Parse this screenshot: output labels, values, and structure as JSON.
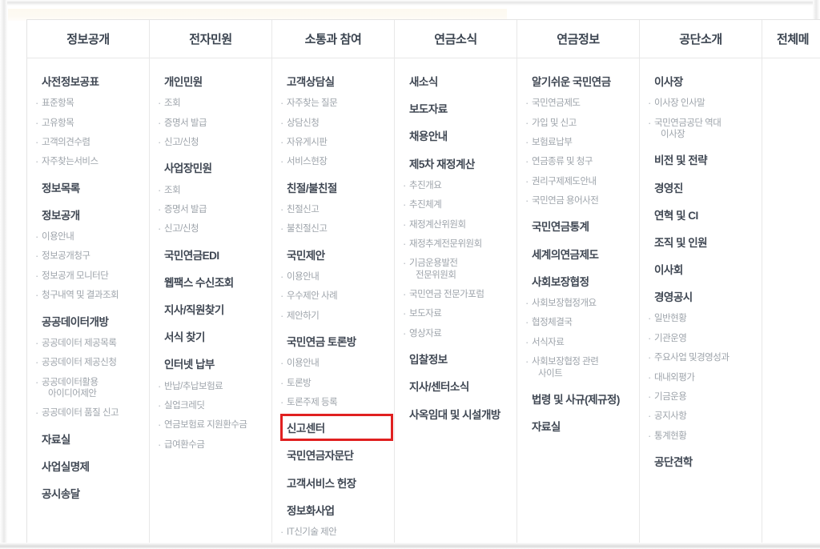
{
  "menu": {
    "columns": [
      {
        "id": "col-information-disclosure",
        "header": "정보공개",
        "groups": [
          {
            "title": "사전정보공표",
            "items": [
              "표준항목",
              "고유항목",
              "고객의견수렴",
              "자주찾는서비스"
            ]
          },
          {
            "title": "정보목록",
            "items": []
          },
          {
            "title": "정보공개",
            "items": [
              "이용안내",
              "정보공개청구",
              "정보공개 모니터단",
              "청구내역 및 결과조회"
            ]
          },
          {
            "title": "공공데이터개방",
            "items": [
              "공공데이터 제공목록",
              "공공데이터 제공신청",
              "공공데이터활용|아이디어제안",
              "공공데이터 품질 신고"
            ]
          },
          {
            "title": "자료실",
            "items": []
          },
          {
            "title": "사업실명제",
            "items": []
          },
          {
            "title": "공시송달",
            "items": []
          }
        ]
      },
      {
        "id": "col-electronic-civil-service",
        "header": "전자민원",
        "groups": [
          {
            "title": "개인민원",
            "items": [
              "조회",
              "증명서 발급",
              "신고/신청"
            ]
          },
          {
            "title": "사업장민원",
            "items": [
              "조회",
              "증명서 발급",
              "신고/신청"
            ]
          },
          {
            "title": "국민연금EDI",
            "items": []
          },
          {
            "title": "웹팩스 수신조회",
            "items": []
          },
          {
            "title": "지사/직원찾기",
            "items": []
          },
          {
            "title": "서식 찾기",
            "items": []
          },
          {
            "title": "인터넷 납부",
            "items": [
              "반납/추납보험료",
              "실업크레딧",
              "연금보험료 지원환수금",
              "급여환수금"
            ]
          }
        ]
      },
      {
        "id": "col-communication-participation",
        "header": "소통과 참여",
        "groups": [
          {
            "title": "고객상담실",
            "items": [
              "자주찾는 질문",
              "상담신청",
              "자유게시판",
              "서비스현장"
            ]
          },
          {
            "title": "친절/불친절",
            "items": [
              "친절신고",
              "불친절신고"
            ]
          },
          {
            "title": "국민제안",
            "items": [
              "이용안내",
              "우수제안 사례",
              "제안하기"
            ]
          },
          {
            "title": "국민연금 토론방",
            "items": [
              "이용안내",
              "토론방",
              "토론주제 등록"
            ]
          },
          {
            "title": "신고센터",
            "items": [],
            "highlighted": true
          },
          {
            "title": "국민연금자문단",
            "items": []
          },
          {
            "title": "고객서비스 헌장",
            "items": []
          },
          {
            "title": "정보화사업",
            "items": [
              "IT신기술 제안"
            ]
          }
        ]
      },
      {
        "id": "col-pension-news",
        "header": "연금소식",
        "groups": [
          {
            "title": "새소식",
            "items": []
          },
          {
            "title": "보도자료",
            "items": []
          },
          {
            "title": "채용안내",
            "items": []
          },
          {
            "title": "제5차 재정계산",
            "items": [
              "추진개요",
              "추진체계",
              "재정계산위원회",
              "재정추계전문위원회",
              "기금운용발전|전문위원회",
              "국민연금 전문가포럼",
              "보도자료",
              "영상자료"
            ]
          },
          {
            "title": "입찰정보",
            "items": []
          },
          {
            "title": "지사/센터소식",
            "items": []
          },
          {
            "title": "사옥임대 및 시설개방",
            "items": []
          }
        ]
      },
      {
        "id": "col-pension-information",
        "header": "연금정보",
        "groups": [
          {
            "title": "알기쉬운 국민연금",
            "items": [
              "국민연금제도",
              "가입 및 신고",
              "보험료납부",
              "연금종류 및 청구",
              "권리구제제도안내",
              "국민연금 용어사전"
            ]
          },
          {
            "title": "국민연금통계",
            "items": []
          },
          {
            "title": "세계의연금제도",
            "items": []
          },
          {
            "title": "사회보장협정",
            "items": [
              "사회보장협정개요",
              "협정체결국",
              "서식자료",
              "사회보장협정 관련|사이트"
            ]
          },
          {
            "title": "법령 및 사규(제규정)",
            "items": []
          },
          {
            "title": "자료실",
            "items": []
          }
        ]
      },
      {
        "id": "col-about-corporation",
        "header": "공단소개",
        "groups": [
          {
            "title": "이사장",
            "items": [
              "이사장 인사말",
              "국민연금공단 역대|이사장"
            ]
          },
          {
            "title": "비전 및 전략",
            "items": []
          },
          {
            "title": "경영진",
            "items": []
          },
          {
            "title": "연혁 및 CI",
            "items": []
          },
          {
            "title": "조직 및 인원",
            "items": []
          },
          {
            "title": "이사회",
            "items": []
          },
          {
            "title": "경영공시",
            "items": [
              "일반현황",
              "기관운영",
              "주요사업 및경영성과",
              "대내외평가",
              "기금운용",
              "공지사항",
              "통계현황"
            ]
          },
          {
            "title": "공단견학",
            "items": []
          }
        ]
      },
      {
        "id": "col-all-menu",
        "header": "전체메",
        "clipped": true,
        "groups": []
      }
    ]
  },
  "annotation": {
    "highlight_label": "신고센터",
    "highlight_color": "#e02020"
  }
}
